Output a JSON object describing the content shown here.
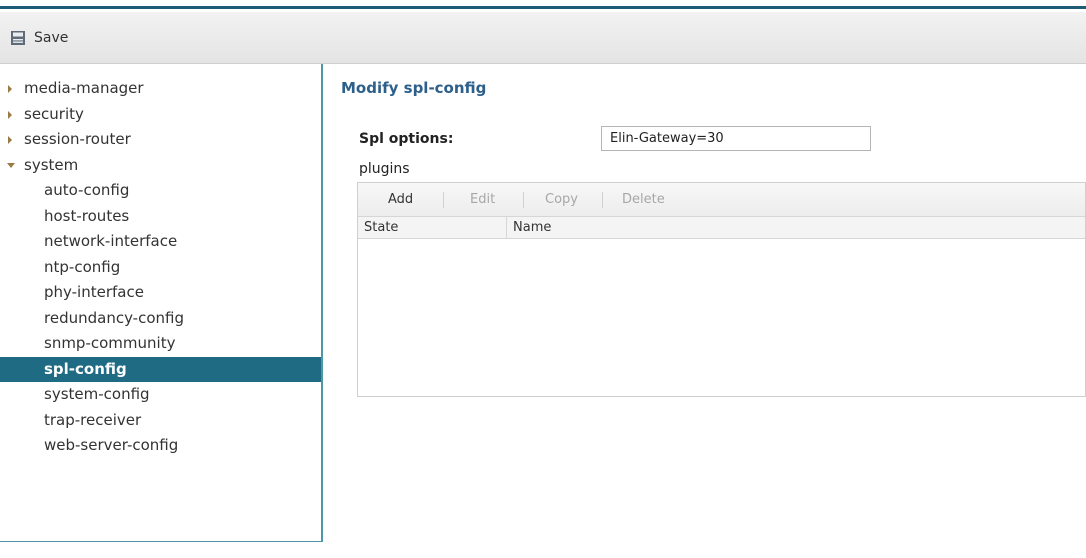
{
  "toolbar": {
    "save_label": "Save",
    "save_icon": "save-icon"
  },
  "sidebar": {
    "items": [
      {
        "label": "media-manager",
        "level": 0,
        "expanded": false
      },
      {
        "label": "security",
        "level": 0,
        "expanded": false
      },
      {
        "label": "session-router",
        "level": 0,
        "expanded": false
      },
      {
        "label": "system",
        "level": 0,
        "expanded": true
      },
      {
        "label": "auto-config",
        "level": 1
      },
      {
        "label": "host-routes",
        "level": 1
      },
      {
        "label": "network-interface",
        "level": 1
      },
      {
        "label": "ntp-config",
        "level": 1
      },
      {
        "label": "phy-interface",
        "level": 1
      },
      {
        "label": "redundancy-config",
        "level": 1
      },
      {
        "label": "snmp-community",
        "level": 1
      },
      {
        "label": "spl-config",
        "level": 1,
        "selected": true
      },
      {
        "label": "system-config",
        "level": 1
      },
      {
        "label": "trap-receiver",
        "level": 1
      },
      {
        "label": "web-server-config",
        "level": 1
      }
    ]
  },
  "main": {
    "title": "Modify spl-config",
    "spl_options_label": "Spl options:",
    "spl_options_value": "Elin-Gateway=30",
    "plugins_label": "plugins",
    "grid": {
      "buttons": [
        {
          "label": "Add",
          "enabled": true
        },
        {
          "label": "Edit",
          "enabled": false
        },
        {
          "label": "Copy",
          "enabled": false
        },
        {
          "label": "Delete",
          "enabled": false
        }
      ],
      "columns": [
        "State",
        "Name"
      ],
      "rows": []
    }
  },
  "colors": {
    "accent": "#1e6b83",
    "title": "#2d5f8b",
    "border": "#4f96a6"
  }
}
